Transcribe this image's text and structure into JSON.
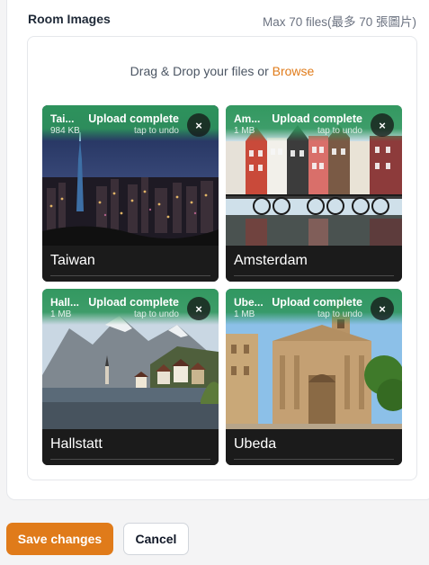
{
  "field": {
    "label": "Room Images",
    "hint": "Max 70 files(最多 70 張圖片)"
  },
  "dropzone": {
    "text": "Drag & Drop your files or ",
    "browse_label": "Browse"
  },
  "tiles": [
    {
      "filename": "Tai...",
      "size": "984 KB",
      "status": "Upload complete",
      "undo": "tap to undo",
      "caption": "Taiwan",
      "close": "×"
    },
    {
      "filename": "Am...",
      "size": "1 MB",
      "status": "Upload complete",
      "undo": "tap to undo",
      "caption": "Amsterdam",
      "close": "×"
    },
    {
      "filename": "Hall...",
      "size": "1 MB",
      "status": "Upload complete",
      "undo": "tap to undo",
      "caption": "Hallstatt",
      "close": "×"
    },
    {
      "filename": "Ube...",
      "size": "1 MB",
      "status": "Upload complete",
      "undo": "tap to undo",
      "caption": "Ubeda",
      "close": "×"
    }
  ],
  "actions": {
    "save_label": "Save changes",
    "cancel_label": "Cancel"
  },
  "colors": {
    "accent": "#e07b1a",
    "upload_success": "#2e965c",
    "caption_bg": "#1b1b1b"
  }
}
